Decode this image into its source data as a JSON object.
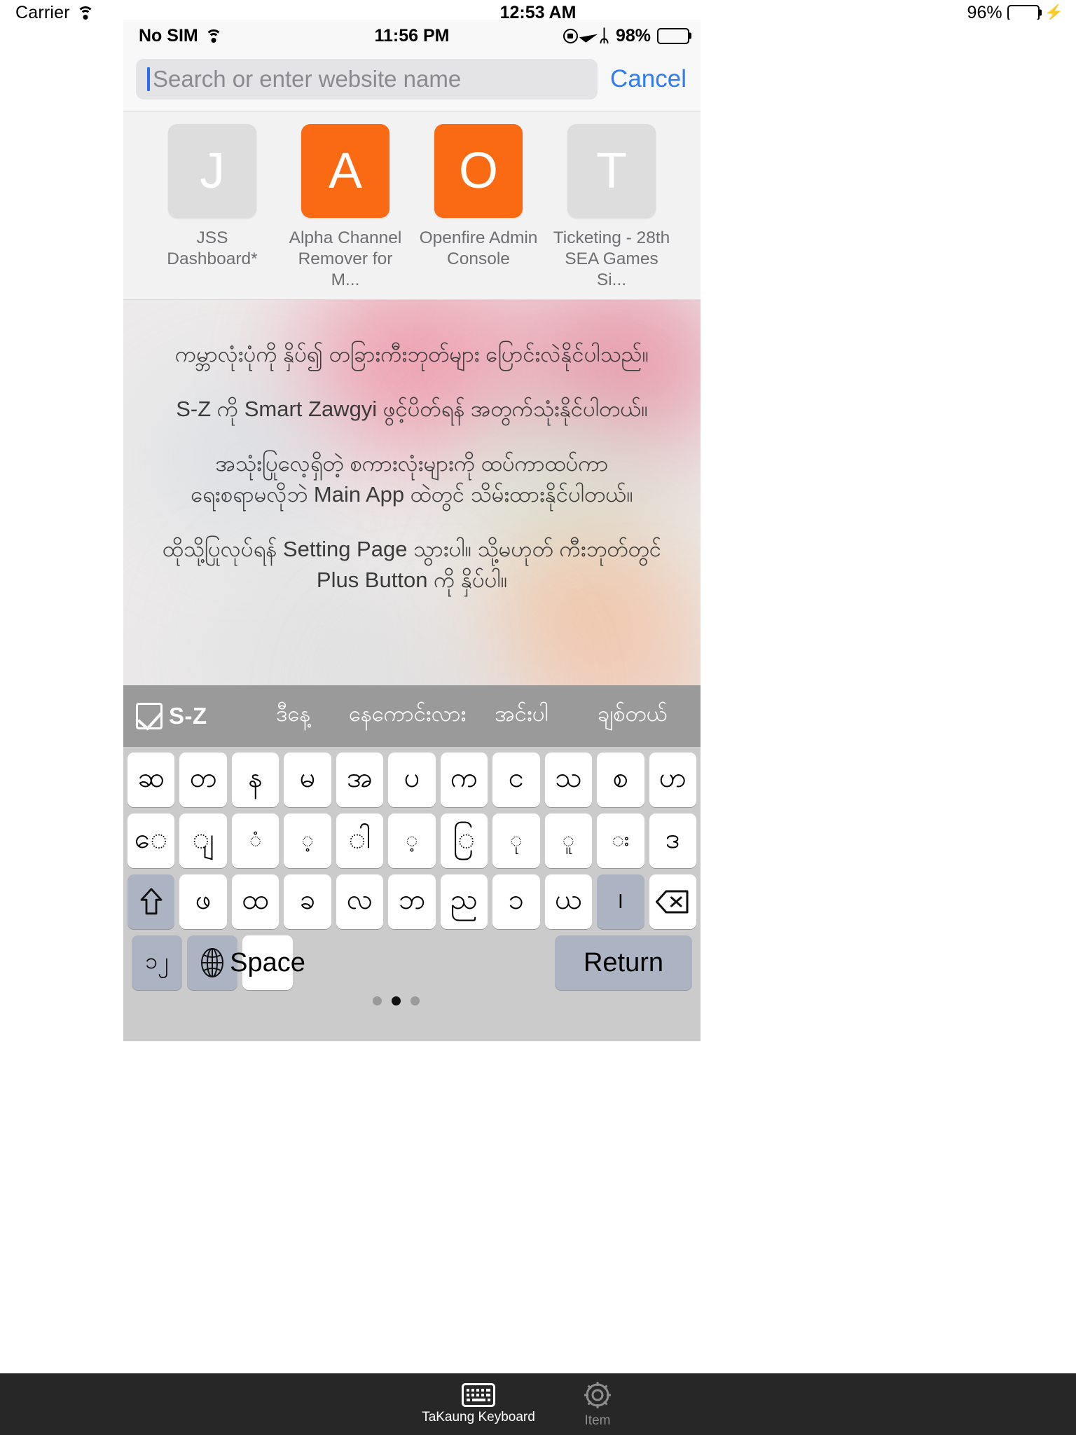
{
  "outer_status": {
    "carrier": "Carrier",
    "wifi_icon": "wifi-icon",
    "time": "12:53 AM",
    "battery_percent": "96%",
    "battery_color": "#4cd964",
    "charging_icon": "lightning-bolt-icon"
  },
  "inner_status": {
    "carrier": "No SIM",
    "wifi_icon": "wifi-icon",
    "time": "11:56 PM",
    "rotation_lock_icon": "rotation-lock-icon",
    "location_icon": "location-arrow-icon",
    "bluetooth_icon": "bluetooth-icon",
    "bluetooth_glyph": "ᛦ",
    "battery_percent": "98%",
    "battery_color": "#000000"
  },
  "browser": {
    "search_placeholder": "Search or enter website name",
    "search_value": "",
    "cancel_label": "Cancel"
  },
  "favorites": [
    {
      "letter": "J",
      "tile_color": "#dddddd",
      "label": "JSS Dashboard*"
    },
    {
      "letter": "A",
      "tile_color": "#f96a13",
      "label": "Alpha Channel\nRemover for M..."
    },
    {
      "letter": "O",
      "tile_color": "#f96a13",
      "label": "Openfire Admin\nConsole"
    },
    {
      "letter": "T",
      "tile_color": "#dddddd",
      "label": "Ticketing - 28th\nSEA Games Si..."
    }
  ],
  "page_content": {
    "paragraphs": [
      "ကမ္ဘာလုံးပုံကို နှိပ်၍ တခြားကီးဘုတ်များ ပြောင်းလဲနိုင်ပါသည်။",
      "S-Z ကို Smart Zawgyi ဖွင့်ပိတ်ရန် အတွက်သုံးနိုင်ပါတယ်။",
      "အသုံးပြုလေ့ရှိတဲ့ စကားလုံးများကို ထပ်ကာထပ်ကာ\nရေးစရာမလိုဘဲ Main App ထဲတွင် သိမ်းထားနိုင်ပါတယ်။",
      "ထိုသို့ပြုလုပ်ရန် Setting Page သွားပါ။ သို့မဟုတ် ကီးဘုတ်တွင်\nPlus Button ကို နှိပ်ပါ။"
    ]
  },
  "keyboard": {
    "suggestion_bar": {
      "checkbox_icon": "checkbox-checked-icon",
      "sz_label": "S-Z",
      "suggestions": [
        "ဒီနေ့",
        "နေကောင်းလား",
        "အင်းပါ",
        "ချစ်တယ်"
      ]
    },
    "row1": [
      "ဆ",
      "တ",
      "န",
      "မ",
      "အ",
      "ပ",
      "က",
      "င",
      "သ",
      "စ",
      "ဟ"
    ],
    "row2": [
      "ေ",
      "ျ",
      "ံ",
      "့",
      "ါ",
      "့",
      "ြ",
      "ု",
      "ူ",
      "း",
      "ဒ"
    ],
    "row3_keys": [
      "ဖ",
      "ထ",
      "ခ",
      "လ",
      "ဘ",
      "ည",
      "၁",
      "ယ",
      "l"
    ],
    "shift_icon": "shift-arrow-icon",
    "delete_icon": "backspace-delete-icon",
    "num_key": "၁၂",
    "globe_icon": "globe-icon",
    "space_label": "Space",
    "return_label": "Return",
    "page_dots": 3,
    "active_dot": 1
  },
  "tabbar": {
    "tabs": [
      {
        "icon": "keyboard-icon",
        "label": "TaKaung Keyboard",
        "active": true
      },
      {
        "icon": "gear-icon",
        "label": "Item",
        "active": false
      }
    ]
  }
}
